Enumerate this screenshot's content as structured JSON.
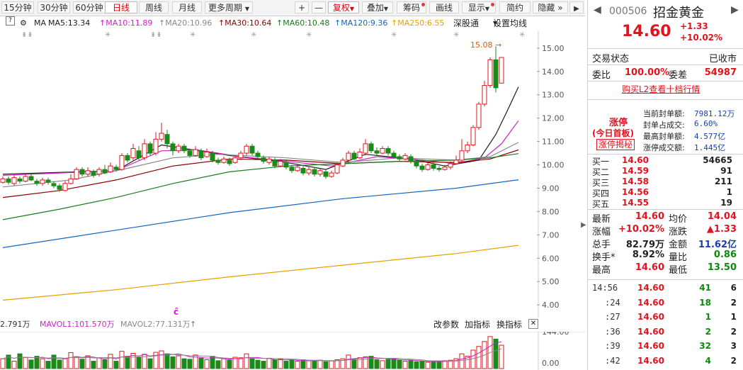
{
  "toolbar": {
    "periods": [
      "15分钟",
      "30分钟",
      "60分钟",
      "日线",
      "周线",
      "月线",
      "更多周期"
    ],
    "active": "日线",
    "tools": [
      "复权",
      "叠加",
      "筹码",
      "画线",
      "显示",
      "简约",
      "隐藏"
    ]
  },
  "ma": {
    "label": "MA",
    "items": [
      {
        "text": "MA5:13.34",
        "color": "#1a1a1a"
      },
      {
        "text": "MA10:11.89",
        "color": "#d020c8"
      },
      {
        "text": "MA20:10.96",
        "color": "#888888"
      },
      {
        "text": "MA30:10.64",
        "color": "#8b0000"
      },
      {
        "text": "MA60:10.48",
        "color": "#1d7a1d"
      },
      {
        "text": "MA120:9.36",
        "color": "#1565c0"
      },
      {
        "text": "MA250:6.55",
        "color": "#e6a100"
      }
    ],
    "link_shengutong": "深股通",
    "settings": "设置均线"
  },
  "chart": {
    "y_ticks": [
      "15.00",
      "14.00",
      "13.00",
      "12.00",
      "11.00",
      "10.00",
      "9.00",
      "8.00",
      "7.00",
      "6.00",
      "5.00",
      "4.00"
    ],
    "high_marker": "15.08",
    "event_mark": "ĉ"
  },
  "volume": {
    "v1": "2.791万",
    "mavol1": "MAVOL1:101.570万",
    "mavol2": "MAVOL2:77.131万",
    "btn_params": "改参数",
    "btn_add": "加指标",
    "btn_switch": "换指标",
    "y_ticks": [
      "144.00",
      "0.00"
    ]
  },
  "quote": {
    "code": "000506",
    "name": "招金黄金",
    "price": "14.60",
    "change": "+1.33",
    "change_pct": "+10.02%",
    "trade_status_label": "交易状态",
    "trade_status": "已收市",
    "weibi_label": "委比",
    "weibi": "100.00%",
    "weicha_label": "委差",
    "weicha": "54987",
    "l2_link": "购买L2查看十档行情",
    "limit": {
      "title": "涨停",
      "badge": "(今日首板)",
      "secret_btn": "涨停揭秘",
      "items": [
        {
          "label": "当前封单额:",
          "value": "7981.12万"
        },
        {
          "label": "封单占成交:",
          "value": "6.60%"
        },
        {
          "label": "最高封单额:",
          "value": "4.577亿"
        },
        {
          "label": "涨停成交额:",
          "value": "1.445亿"
        }
      ]
    },
    "bids": [
      {
        "label": "买一",
        "price": "14.60",
        "vol": "54665"
      },
      {
        "label": "买二",
        "price": "14.59",
        "vol": "91"
      },
      {
        "label": "买三",
        "price": "14.58",
        "vol": "211"
      },
      {
        "label": "买四",
        "price": "14.56",
        "vol": "1"
      },
      {
        "label": "买五",
        "price": "14.55",
        "vol": "19"
      }
    ],
    "stats": [
      {
        "l1": "最新",
        "v1": "14.60",
        "l2": "均价",
        "v2": "14.04"
      },
      {
        "l1": "涨幅",
        "v1": "+10.02%",
        "l2": "涨跌",
        "v2": "▲1.33"
      },
      {
        "l1": "总手",
        "v1": "82.79万",
        "l2": "金额",
        "v2": "11.62亿"
      },
      {
        "l1": "换手*",
        "v1": "8.92%",
        "l2": "量比",
        "v2": "0.86"
      },
      {
        "l1": "最高",
        "v1": "14.60",
        "l2": "最低",
        "v2": "13.50"
      }
    ],
    "ticks": [
      {
        "time": "14:56",
        "price": "14.60",
        "vol": "41",
        "n": "6"
      },
      {
        "time": ":24",
        "price": "14.60",
        "vol": "18",
        "n": "2"
      },
      {
        "time": ":27",
        "price": "14.60",
        "vol": "1",
        "n": "1"
      },
      {
        "time": ":36",
        "price": "14.60",
        "vol": "2",
        "n": "2"
      },
      {
        "time": ":39",
        "price": "14.60",
        "vol": "32",
        "n": "3"
      },
      {
        "time": ":42",
        "price": "14.60",
        "vol": "4",
        "n": "2"
      }
    ]
  },
  "chart_data": {
    "type": "candlestick",
    "ylim": [
      3.7,
      15.3
    ],
    "y_ticks": [
      15,
      14,
      13,
      12,
      11,
      10,
      9,
      8,
      7,
      6,
      5,
      4
    ],
    "high_marker": 15.08,
    "candles": [
      {
        "o": 9.25,
        "c": 9.4,
        "h": 9.5,
        "l": 9.2
      },
      {
        "o": 9.4,
        "c": 9.25,
        "h": 9.5,
        "l": 9.15
      },
      {
        "o": 9.2,
        "c": 9.45,
        "h": 9.55,
        "l": 9.1
      },
      {
        "o": 9.4,
        "c": 9.3,
        "h": 9.5,
        "l": 9.2
      },
      {
        "o": 9.3,
        "c": 9.5,
        "h": 9.6,
        "l": 9.25
      },
      {
        "o": 9.5,
        "c": 9.35,
        "h": 9.6,
        "l": 9.3
      },
      {
        "o": 9.3,
        "c": 9.2,
        "h": 9.4,
        "l": 9.1
      },
      {
        "o": 9.2,
        "c": 9.35,
        "h": 9.45,
        "l": 9.1
      },
      {
        "o": 9.35,
        "c": 9.25,
        "h": 9.45,
        "l": 9.15
      },
      {
        "o": 9.2,
        "c": 9.1,
        "h": 9.3,
        "l": 9.0
      },
      {
        "o": 9.1,
        "c": 8.95,
        "h": 9.2,
        "l": 8.85
      },
      {
        "o": 8.9,
        "c": 9.2,
        "h": 9.3,
        "l": 8.85
      },
      {
        "o": 9.2,
        "c": 9.4,
        "h": 9.6,
        "l": 9.15
      },
      {
        "o": 9.4,
        "c": 9.8,
        "h": 9.9,
        "l": 9.35
      },
      {
        "o": 9.8,
        "c": 9.6,
        "h": 9.9,
        "l": 9.5
      },
      {
        "o": 9.6,
        "c": 9.75,
        "h": 9.9,
        "l": 9.5
      },
      {
        "o": 9.7,
        "c": 9.55,
        "h": 9.8,
        "l": 9.45
      },
      {
        "o": 9.6,
        "c": 9.8,
        "h": 9.9,
        "l": 9.5
      },
      {
        "o": 9.8,
        "c": 9.65,
        "h": 10.0,
        "l": 9.6
      },
      {
        "o": 9.7,
        "c": 9.95,
        "h": 10.1,
        "l": 9.65
      },
      {
        "o": 9.9,
        "c": 9.8,
        "h": 10.0,
        "l": 9.7
      },
      {
        "o": 9.8,
        "c": 10.4,
        "h": 10.5,
        "l": 9.75
      },
      {
        "o": 10.4,
        "c": 10.2,
        "h": 10.5,
        "l": 10.1
      },
      {
        "o": 10.3,
        "c": 10.7,
        "h": 10.9,
        "l": 10.2
      },
      {
        "o": 10.6,
        "c": 10.3,
        "h": 10.8,
        "l": 10.2
      },
      {
        "o": 10.3,
        "c": 10.9,
        "h": 11.1,
        "l": 10.2
      },
      {
        "o": 10.9,
        "c": 10.5,
        "h": 11.0,
        "l": 10.4
      },
      {
        "o": 10.5,
        "c": 11.1,
        "h": 11.4,
        "l": 10.4
      },
      {
        "o": 11.1,
        "c": 11.35,
        "h": 11.8,
        "l": 11.0
      },
      {
        "o": 11.3,
        "c": 10.9,
        "h": 11.5,
        "l": 10.7
      },
      {
        "o": 10.9,
        "c": 10.6,
        "h": 11.0,
        "l": 10.4
      },
      {
        "o": 10.6,
        "c": 10.8,
        "h": 10.9,
        "l": 10.5
      },
      {
        "o": 10.8,
        "c": 10.6,
        "h": 10.9,
        "l": 10.5
      },
      {
        "o": 10.6,
        "c": 10.4,
        "h": 10.7,
        "l": 10.3
      },
      {
        "o": 10.4,
        "c": 10.65,
        "h": 10.8,
        "l": 10.35
      },
      {
        "o": 10.6,
        "c": 10.3,
        "h": 10.7,
        "l": 10.2
      },
      {
        "o": 10.35,
        "c": 10.55,
        "h": 10.7,
        "l": 10.3
      },
      {
        "o": 10.5,
        "c": 10.2,
        "h": 10.6,
        "l": 10.1
      },
      {
        "o": 10.2,
        "c": 10.1,
        "h": 10.3,
        "l": 10.0
      },
      {
        "o": 10.1,
        "c": 10.25,
        "h": 10.35,
        "l": 10.05
      },
      {
        "o": 10.2,
        "c": 10.05,
        "h": 10.3,
        "l": 9.95
      },
      {
        "o": 10.1,
        "c": 10.3,
        "h": 10.4,
        "l": 10.05
      },
      {
        "o": 10.3,
        "c": 10.5,
        "h": 10.6,
        "l": 10.2
      },
      {
        "o": 10.5,
        "c": 10.8,
        "h": 10.9,
        "l": 10.4
      },
      {
        "o": 10.8,
        "c": 10.5,
        "h": 10.9,
        "l": 10.4
      },
      {
        "o": 10.5,
        "c": 10.35,
        "h": 10.6,
        "l": 10.25
      },
      {
        "o": 10.3,
        "c": 10.15,
        "h": 10.4,
        "l": 10.05
      },
      {
        "o": 10.1,
        "c": 10.25,
        "h": 10.35,
        "l": 10.0
      },
      {
        "o": 10.2,
        "c": 9.95,
        "h": 10.3,
        "l": 9.85
      },
      {
        "o": 9.95,
        "c": 10.15,
        "h": 10.25,
        "l": 9.9
      },
      {
        "o": 10.1,
        "c": 9.9,
        "h": 10.2,
        "l": 9.8
      },
      {
        "o": 9.9,
        "c": 9.75,
        "h": 10.0,
        "l": 9.65
      },
      {
        "o": 9.75,
        "c": 9.9,
        "h": 10.0,
        "l": 9.7
      },
      {
        "o": 9.85,
        "c": 9.65,
        "h": 9.95,
        "l": 9.55
      },
      {
        "o": 9.65,
        "c": 9.8,
        "h": 9.9,
        "l": 9.55
      },
      {
        "o": 9.8,
        "c": 9.6,
        "h": 9.9,
        "l": 9.5
      },
      {
        "o": 9.6,
        "c": 9.75,
        "h": 9.85,
        "l": 9.5
      },
      {
        "o": 9.7,
        "c": 9.5,
        "h": 9.8,
        "l": 9.4
      },
      {
        "o": 9.5,
        "c": 9.65,
        "h": 9.75,
        "l": 9.45
      },
      {
        "o": 9.65,
        "c": 10.0,
        "h": 10.1,
        "l": 9.6
      },
      {
        "o": 9.95,
        "c": 10.2,
        "h": 10.3,
        "l": 9.9
      },
      {
        "o": 10.2,
        "c": 10.5,
        "h": 10.6,
        "l": 10.1
      },
      {
        "o": 10.5,
        "c": 10.25,
        "h": 10.6,
        "l": 10.2
      },
      {
        "o": 10.3,
        "c": 10.55,
        "h": 10.7,
        "l": 10.25
      },
      {
        "o": 10.5,
        "c": 10.9,
        "h": 11.1,
        "l": 10.4
      },
      {
        "o": 10.9,
        "c": 10.6,
        "h": 11.0,
        "l": 10.5
      },
      {
        "o": 10.6,
        "c": 10.5,
        "h": 10.75,
        "l": 10.4
      },
      {
        "o": 10.5,
        "c": 10.7,
        "h": 10.8,
        "l": 10.45
      },
      {
        "o": 10.7,
        "c": 10.5,
        "h": 10.8,
        "l": 10.4
      },
      {
        "o": 10.5,
        "c": 10.35,
        "h": 10.6,
        "l": 10.25
      },
      {
        "o": 10.35,
        "c": 10.25,
        "h": 10.45,
        "l": 10.15
      },
      {
        "o": 10.25,
        "c": 10.4,
        "h": 10.5,
        "l": 10.2
      },
      {
        "o": 10.35,
        "c": 10.15,
        "h": 10.45,
        "l": 10.05
      },
      {
        "o": 10.15,
        "c": 9.95,
        "h": 10.2,
        "l": 9.85
      },
      {
        "o": 9.95,
        "c": 9.8,
        "h": 10.05,
        "l": 9.7
      },
      {
        "o": 9.8,
        "c": 10.0,
        "h": 10.1,
        "l": 9.75
      },
      {
        "o": 10.0,
        "c": 9.85,
        "h": 10.1,
        "l": 9.75
      },
      {
        "o": 9.85,
        "c": 9.8,
        "h": 9.95,
        "l": 9.7
      },
      {
        "o": 9.8,
        "c": 9.9,
        "h": 10.0,
        "l": 9.75
      },
      {
        "o": 9.9,
        "c": 10.05,
        "h": 10.15,
        "l": 9.8
      },
      {
        "o": 10.05,
        "c": 10.2,
        "h": 10.4,
        "l": 10.0
      },
      {
        "o": 10.2,
        "c": 10.6,
        "h": 11.1,
        "l": 10.1
      },
      {
        "o": 10.6,
        "c": 10.85,
        "h": 11.0,
        "l": 10.5
      },
      {
        "o": 10.85,
        "c": 11.6,
        "h": 11.7,
        "l": 10.8
      },
      {
        "o": 11.6,
        "c": 12.6,
        "h": 12.7,
        "l": 11.5
      },
      {
        "o": 12.6,
        "c": 13.4,
        "h": 13.6,
        "l": 12.5
      },
      {
        "o": 13.4,
        "c": 14.5,
        "h": 14.6,
        "l": 13.3
      },
      {
        "o": 14.5,
        "c": 13.3,
        "h": 15.08,
        "l": 13.1
      },
      {
        "o": 13.5,
        "c": 14.6,
        "h": 14.6,
        "l": 13.5
      }
    ],
    "ma_series": [
      {
        "name": "MA5",
        "color": "#1a1a1a",
        "pts": [
          [
            0,
            9.6
          ],
          [
            20,
            9.75
          ],
          [
            28,
            10.85
          ],
          [
            32,
            10.7
          ],
          [
            40,
            10.4
          ],
          [
            50,
            10.1
          ],
          [
            57,
            9.8
          ],
          [
            64,
            10.45
          ],
          [
            72,
            10.25
          ],
          [
            78,
            9.95
          ],
          [
            84,
            10.2
          ],
          [
            87,
            11.3
          ],
          [
            89,
            12.3
          ],
          [
            91,
            13.34
          ]
        ]
      },
      {
        "name": "MA10",
        "color": "#d020c8",
        "pts": [
          [
            0,
            9.55
          ],
          [
            20,
            9.75
          ],
          [
            28,
            10.6
          ],
          [
            34,
            10.65
          ],
          [
            42,
            10.35
          ],
          [
            52,
            10.1
          ],
          [
            58,
            9.95
          ],
          [
            66,
            10.35
          ],
          [
            74,
            10.2
          ],
          [
            80,
            10.05
          ],
          [
            85,
            10.3
          ],
          [
            88,
            10.9
          ],
          [
            91,
            11.89
          ]
        ]
      },
      {
        "name": "MA20",
        "color": "#888888",
        "pts": [
          [
            0,
            9.05
          ],
          [
            12,
            9.35
          ],
          [
            22,
            9.85
          ],
          [
            30,
            10.3
          ],
          [
            38,
            10.45
          ],
          [
            50,
            10.3
          ],
          [
            60,
            10.1
          ],
          [
            70,
            10.3
          ],
          [
            80,
            10.2
          ],
          [
            86,
            10.35
          ],
          [
            91,
            10.96
          ]
        ]
      },
      {
        "name": "MA30",
        "color": "#8b0000",
        "pts": [
          [
            0,
            8.6
          ],
          [
            10,
            8.9
          ],
          [
            20,
            9.35
          ],
          [
            30,
            9.95
          ],
          [
            40,
            10.25
          ],
          [
            50,
            10.2
          ],
          [
            60,
            10.05
          ],
          [
            70,
            10.15
          ],
          [
            80,
            10.1
          ],
          [
            86,
            10.25
          ],
          [
            91,
            10.64
          ]
        ]
      },
      {
        "name": "MA60",
        "color": "#1d7a1d",
        "pts": [
          [
            0,
            7.65
          ],
          [
            10,
            8.1
          ],
          [
            20,
            8.6
          ],
          [
            30,
            9.2
          ],
          [
            40,
            9.7
          ],
          [
            50,
            9.95
          ],
          [
            60,
            10.05
          ],
          [
            70,
            10.15
          ],
          [
            80,
            10.2
          ],
          [
            86,
            10.3
          ],
          [
            91,
            10.48
          ]
        ]
      },
      {
        "name": "MA120",
        "color": "#1565c0",
        "pts": [
          [
            0,
            6.45
          ],
          [
            20,
            7.2
          ],
          [
            40,
            7.95
          ],
          [
            60,
            8.55
          ],
          [
            80,
            9.0
          ],
          [
            91,
            9.36
          ]
        ]
      },
      {
        "name": "MA250",
        "color": "#e6a100",
        "pts": [
          [
            0,
            4.2
          ],
          [
            20,
            4.65
          ],
          [
            40,
            5.2
          ],
          [
            60,
            5.7
          ],
          [
            80,
            6.2
          ],
          [
            91,
            6.55
          ]
        ]
      }
    ],
    "volumes": [
      40,
      55,
      30,
      60,
      45,
      35,
      50,
      40,
      30,
      55,
      35,
      40,
      65,
      48,
      38,
      52,
      30,
      44,
      36,
      58,
      30,
      70,
      50,
      62,
      45,
      58,
      40,
      66,
      72,
      60,
      48,
      52,
      40,
      38,
      55,
      42,
      36,
      50,
      32,
      40,
      35,
      46,
      44,
      60,
      40,
      34,
      30,
      42,
      36,
      38,
      30,
      34,
      30,
      36,
      32,
      30,
      34,
      28,
      32,
      36,
      40,
      55,
      38,
      44,
      48,
      50,
      36,
      32,
      38,
      40,
      34,
      30,
      32,
      28,
      30,
      26,
      28,
      30,
      32,
      34,
      40,
      60,
      50,
      75,
      90,
      110,
      130,
      120,
      95
    ],
    "vol_ylim": [
      0,
      144
    ]
  }
}
